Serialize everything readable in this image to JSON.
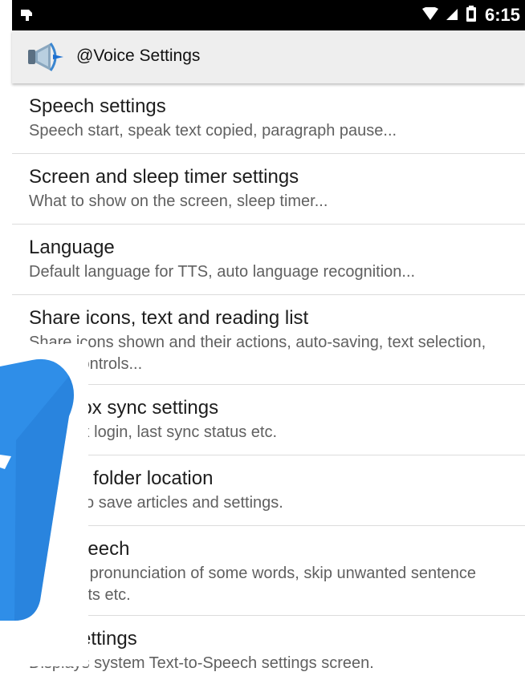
{
  "status_bar": {
    "time": "6:15",
    "icons": [
      "usb-icon",
      "wifi-icon",
      "signal-icon",
      "battery-icon"
    ]
  },
  "app_bar": {
    "title": "@Voice Settings",
    "icon": "megaphone-icon"
  },
  "settings": [
    {
      "title": "Speech settings",
      "subtitle": "Speech start, speak text copied, paragraph pause..."
    },
    {
      "title": "Screen and sleep timer settings",
      "subtitle": "What to show on the screen, sleep timer..."
    },
    {
      "title": "Language",
      "subtitle": "Default language for TTS, auto language recognition..."
    },
    {
      "title": "Share icons, text and reading list",
      "subtitle": "Share icons shown and their actions, auto-saving, text selection, zoom controls..."
    },
    {
      "title": "Dropbox sync settings",
      "subtitle": "Dropbox login, last sync status etc."
    },
    {
      "title": "Device folder location",
      "subtitle": "Where to save articles and settings."
    },
    {
      "title": "Edit speech",
      "subtitle": "Change pronunciation of some words, skip unwanted sentence fragments etc."
    },
    {
      "title": "TTS settings",
      "subtitle": "Displays system Text-to-Speech settings screen."
    }
  ],
  "colors": {
    "status_bar": "#000000",
    "app_bar": "#eeeeee",
    "overlay_blue": "#2f8ee8"
  }
}
